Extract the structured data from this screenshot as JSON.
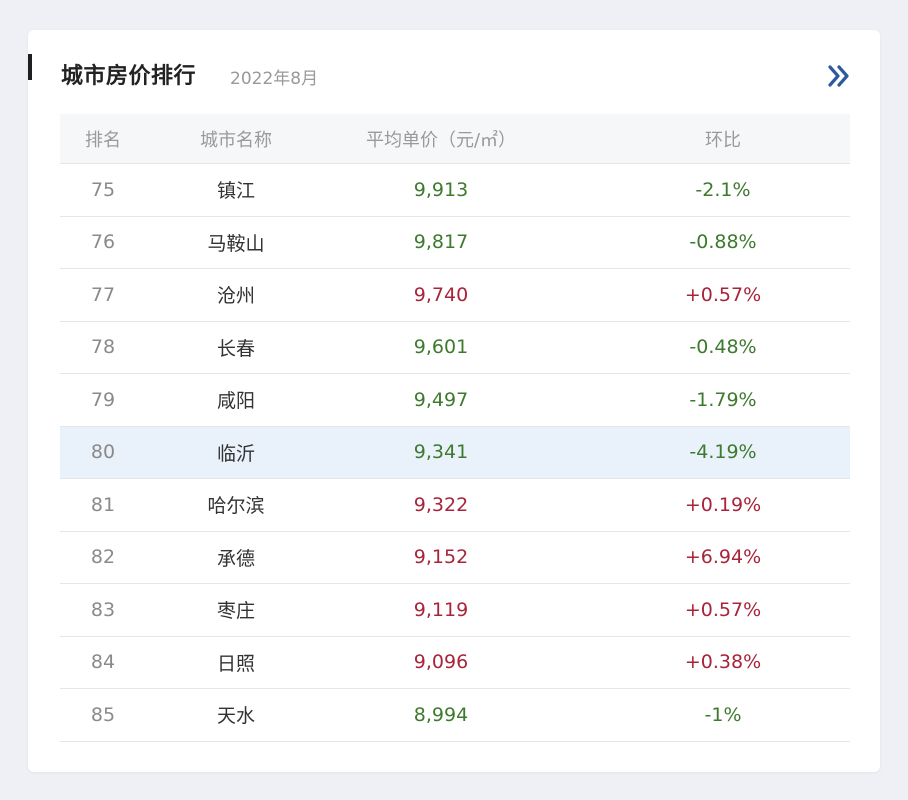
{
  "header": {
    "title": "城市房价排行",
    "subtitle": "2022年8月",
    "more_icon": "double-chevron-right-icon"
  },
  "table": {
    "columns": {
      "rank": "排名",
      "city": "城市名称",
      "price": "平均单价（元/㎡）",
      "change": "环比"
    },
    "rows": [
      {
        "rank": "75",
        "city": "镇江",
        "price": "9,913",
        "change": "-2.1%",
        "dir": "down"
      },
      {
        "rank": "76",
        "city": "马鞍山",
        "price": "9,817",
        "change": "-0.88%",
        "dir": "down"
      },
      {
        "rank": "77",
        "city": "沧州",
        "price": "9,740",
        "change": "+0.57%",
        "dir": "up"
      },
      {
        "rank": "78",
        "city": "长春",
        "price": "9,601",
        "change": "-0.48%",
        "dir": "down"
      },
      {
        "rank": "79",
        "city": "咸阳",
        "price": "9,497",
        "change": "-1.79%",
        "dir": "down"
      },
      {
        "rank": "80",
        "city": "临沂",
        "price": "9,341",
        "change": "-4.19%",
        "dir": "down",
        "highlighted": true
      },
      {
        "rank": "81",
        "city": "哈尔滨",
        "price": "9,322",
        "change": "+0.19%",
        "dir": "up"
      },
      {
        "rank": "82",
        "city": "承德",
        "price": "9,152",
        "change": "+6.94%",
        "dir": "up"
      },
      {
        "rank": "83",
        "city": "枣庄",
        "price": "9,119",
        "change": "+0.57%",
        "dir": "up"
      },
      {
        "rank": "84",
        "city": "日照",
        "price": "9,096",
        "change": "+0.38%",
        "dir": "up"
      },
      {
        "rank": "85",
        "city": "天水",
        "price": "8,994",
        "change": "-1%",
        "dir": "down"
      }
    ]
  },
  "colors": {
    "up": "#a8243a",
    "down": "#3d7a2e",
    "accent": "#2d5a9e",
    "highlight_row": "#e9f1fb"
  }
}
